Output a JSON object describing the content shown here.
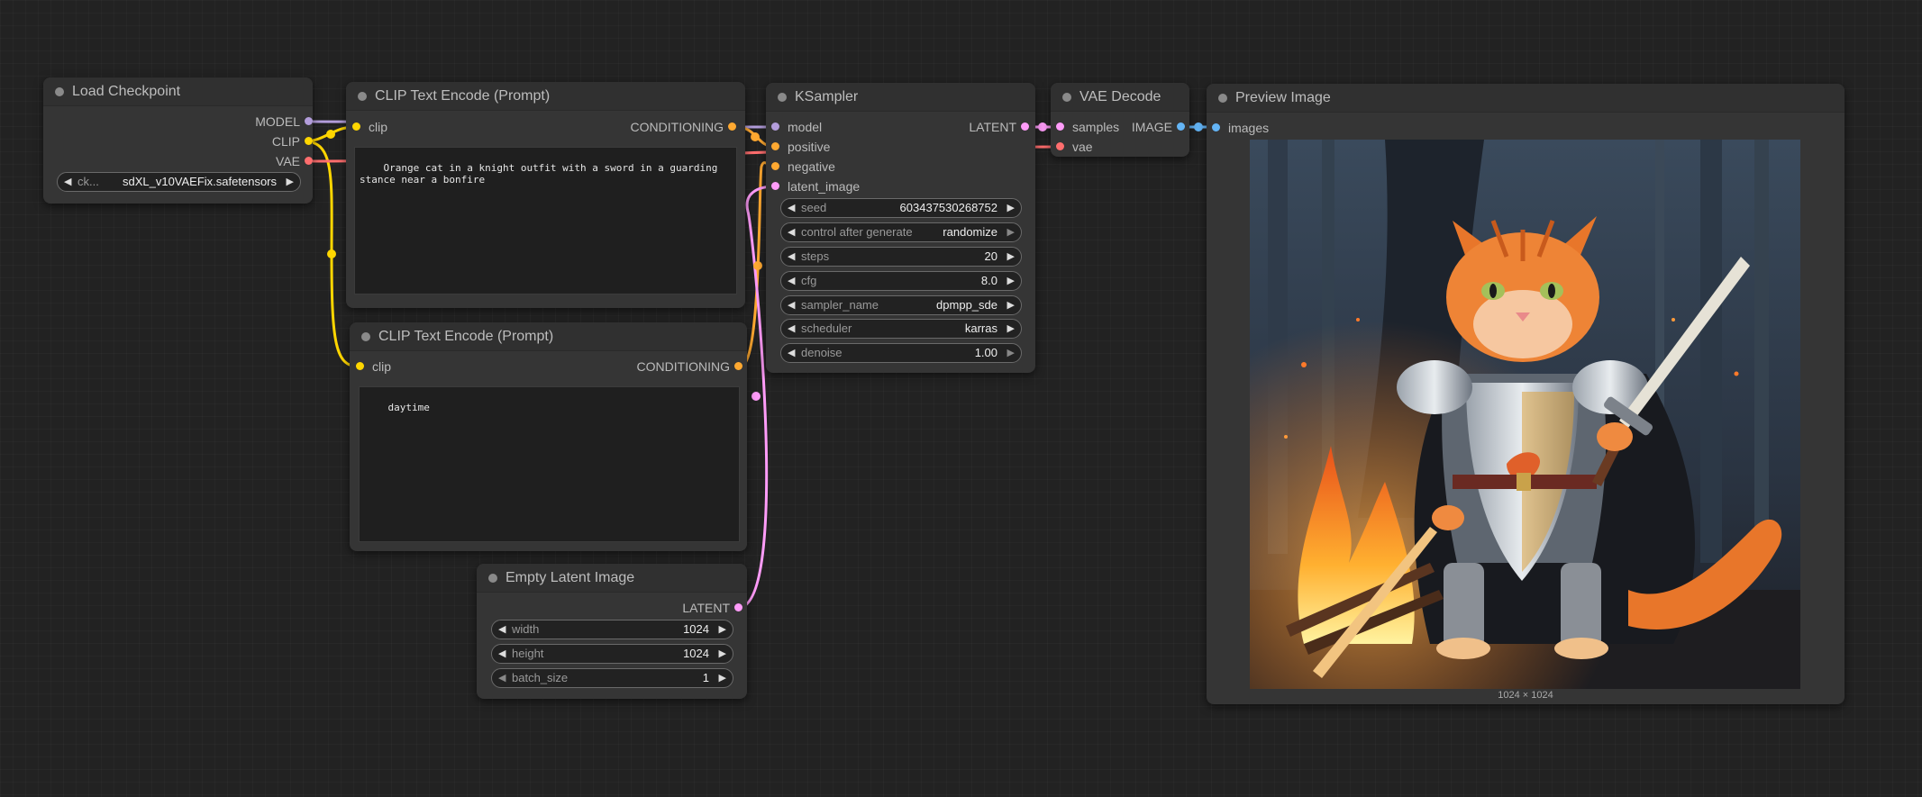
{
  "colors": {
    "model": "#b39ddb",
    "clip": "#ffd600",
    "vae": "#ff6e6e",
    "conditioning": "#ffa931",
    "latent": "#ff9cf9",
    "image": "#64b5f6"
  },
  "nodes": {
    "load_checkpoint": {
      "title": "Load Checkpoint",
      "outputs": [
        "MODEL",
        "CLIP",
        "VAE"
      ],
      "widget": {
        "label": "ck...",
        "value": "sdXL_v10VAEFix.safetensors"
      }
    },
    "clip_encode_pos": {
      "title": "CLIP Text Encode (Prompt)",
      "input": "clip",
      "output": "CONDITIONING",
      "text": "Orange cat in a knight outfit with a sword in a guarding stance near a bonfire"
    },
    "clip_encode_neg": {
      "title": "CLIP Text Encode (Prompt)",
      "input": "clip",
      "output": "CONDITIONING",
      "text": "daytime"
    },
    "empty_latent": {
      "title": "Empty Latent Image",
      "output": "LATENT",
      "widgets": [
        {
          "label": "width",
          "value": "1024"
        },
        {
          "label": "height",
          "value": "1024"
        },
        {
          "label": "batch_size",
          "value": "1"
        }
      ]
    },
    "ksampler": {
      "title": "KSampler",
      "inputs": [
        "model",
        "positive",
        "negative",
        "latent_image"
      ],
      "output": "LATENT",
      "widgets": [
        {
          "label": "seed",
          "value": "603437530268752"
        },
        {
          "label": "control after generate",
          "value": "randomize"
        },
        {
          "label": "steps",
          "value": "20"
        },
        {
          "label": "cfg",
          "value": "8.0"
        },
        {
          "label": "sampler_name",
          "value": "dpmpp_sde"
        },
        {
          "label": "scheduler",
          "value": "karras"
        },
        {
          "label": "denoise",
          "value": "1.00"
        }
      ]
    },
    "vae_decode": {
      "title": "VAE Decode",
      "inputs": [
        "samples",
        "vae"
      ],
      "output": "IMAGE"
    },
    "preview_image": {
      "title": "Preview Image",
      "input": "images",
      "dimensions": "1024 × 1024"
    }
  }
}
